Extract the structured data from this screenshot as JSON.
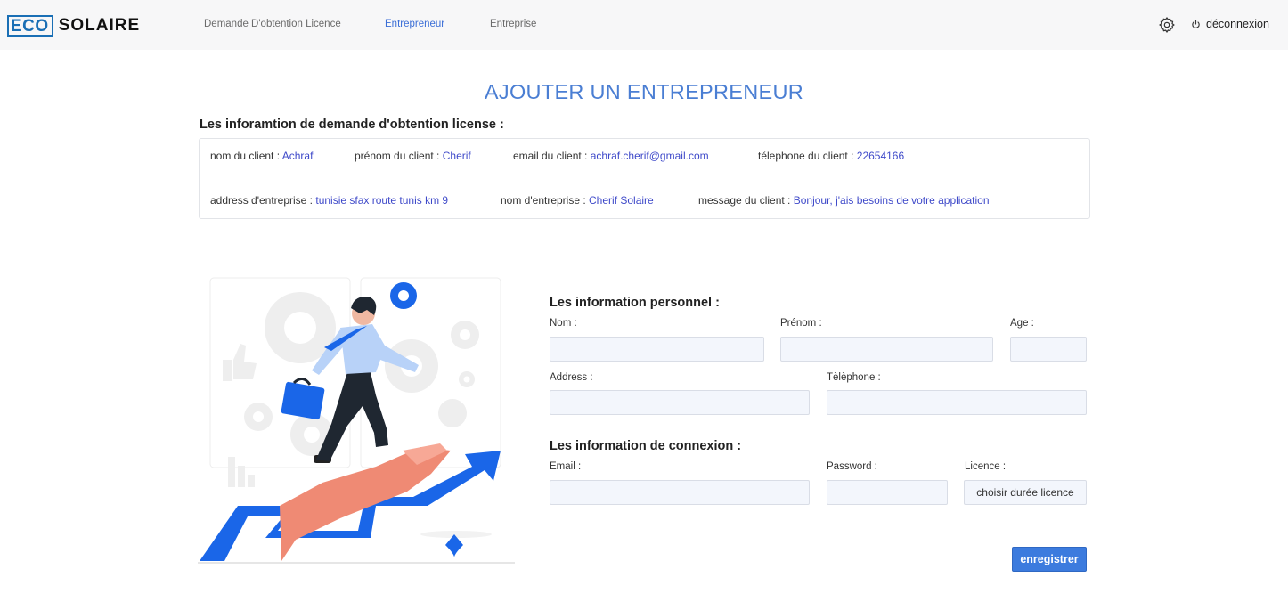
{
  "nav": {
    "logo_part1": "ECO",
    "logo_part2": "SOLAIRE",
    "links": [
      {
        "label": "Demande D'obtention Licence",
        "active": false
      },
      {
        "label": "Entrepreneur",
        "active": true
      },
      {
        "label": "Entreprise",
        "active": false
      }
    ],
    "settings_icon": "gear-icon",
    "logout_icon": "power-icon",
    "logout_label": "déconnexion"
  },
  "page": {
    "title": "AJOUTER UN ENTREPRENEUR",
    "request_heading": "Les inforamtion de demande d'obtention license :"
  },
  "request_info": {
    "nom": {
      "label": "nom du client :",
      "value": "Achraf"
    },
    "prenom": {
      "label": "prénom du client :",
      "value": "Cherif"
    },
    "email": {
      "label": "email du client :",
      "value": "achraf.cherif@gmail.com"
    },
    "telephone": {
      "label": "télephone du client :",
      "value": "22654166"
    },
    "address": {
      "label": "address d'entreprise :",
      "value": "tunisie sfax route tunis km 9"
    },
    "entreprise": {
      "label": "nom d'entreprise :",
      "value": "Cherif Solaire"
    },
    "message": {
      "label": "message du client :",
      "value": "Bonjour, j'ais besoins de votre application"
    }
  },
  "form": {
    "personal_heading": "Les information personnel :",
    "connexion_heading": "Les information de connexion :",
    "nom_label": "Nom :",
    "prenom_label": "Prénom :",
    "age_label": "Age :",
    "address_label": "Address :",
    "telephone_label": "Tèlèphone :",
    "email_label": "Email :",
    "password_label": "Password :",
    "licence_label": "Licence :",
    "licence_selected": "choisir durée licence",
    "values": {
      "nom": "",
      "prenom": "",
      "age": "",
      "address": "",
      "telephone": "",
      "email": "",
      "password": ""
    },
    "save_label": "enregistrer"
  },
  "colors": {
    "accent": "#3c7bde",
    "title": "#4a7ed3",
    "value_text": "#3e49c9",
    "logo_blue": "#1a6fb5"
  }
}
